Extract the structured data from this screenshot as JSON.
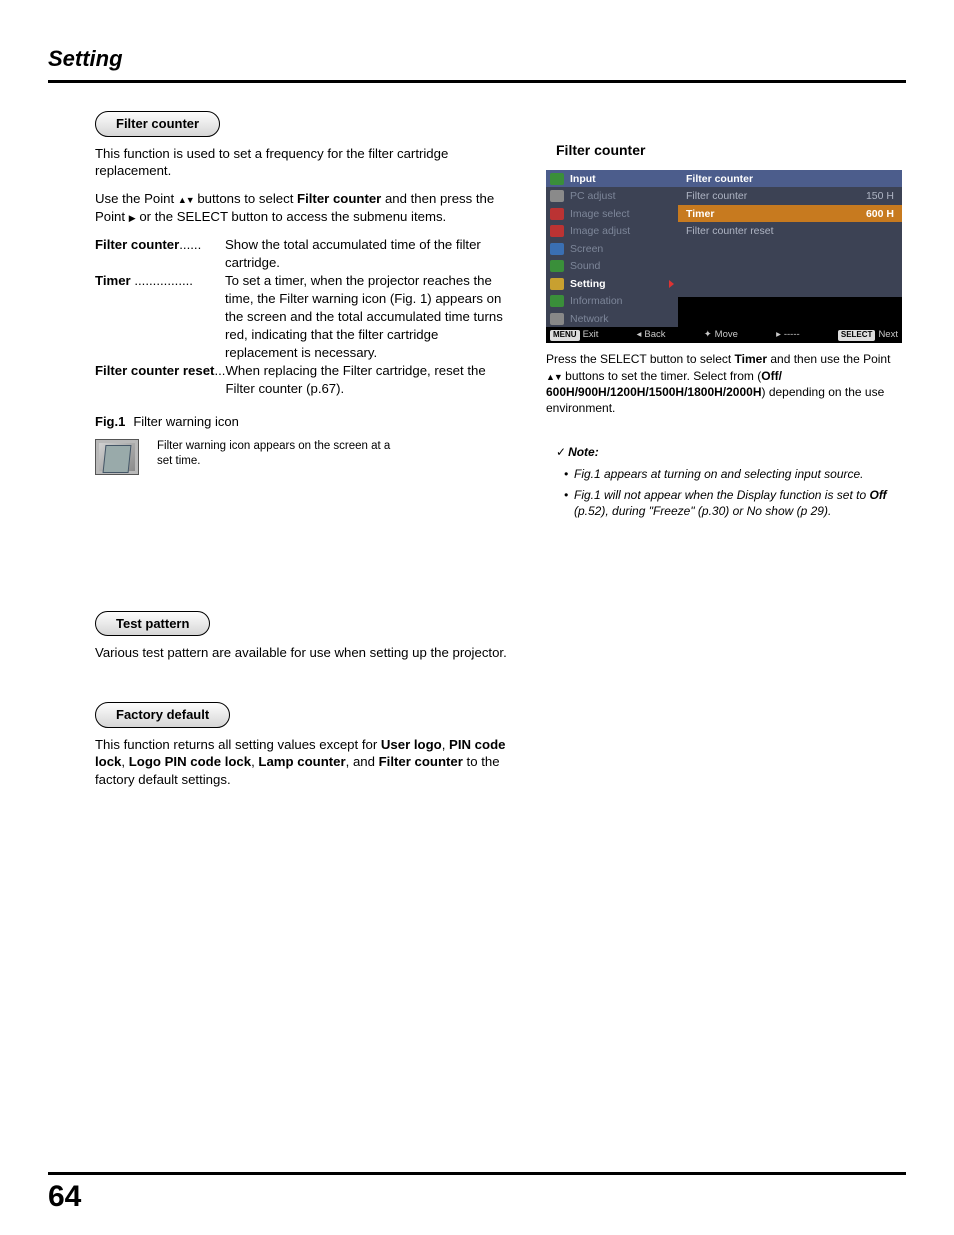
{
  "header": {
    "title": "Setting"
  },
  "pageNumber": "64",
  "pills": {
    "filterCounter": "Filter counter",
    "testPattern": "Test pattern",
    "factoryDefault": "Factory default"
  },
  "intro": {
    "p1": "This function is used to set a frequency for the filter cartridge replacement.",
    "p2a": "Use the Point ",
    "p2b": " buttons to select ",
    "p2bold": "Filter counter",
    "p2c": " and then press the Point ",
    "p2d": " or the SELECT button to access the submenu items."
  },
  "defs": {
    "d1term": "Filter counter",
    "d1dots": "......",
    "d1desc": "Show the total accumulated time of the filter cartridge.",
    "d2term": "Timer",
    "d2dots": " ................",
    "d2desc": "To set a timer, when the projector reaches the time, the Filter warning icon (Fig. 1) appears on the screen and the total accumulated time turns red, indicating that the filter cartridge replacement is necessary.",
    "d3term": "Filter counter reset",
    "d3dots": "...",
    "d3desc": "When replacing the Filter cartridge, reset the Filter counter (p.67)."
  },
  "fig1": {
    "label": "Fig.1",
    "title": "Filter warning icon",
    "caption": "Filter warning icon appears on the screen at a set time."
  },
  "testPattern": {
    "body": "Various test pattern are available for use when setting up the projector."
  },
  "factoryDefault": {
    "pre": "This function returns all setting values except for ",
    "b1": "User logo",
    "s1": ", ",
    "b2": "PIN code lock",
    "s2": ", ",
    "b3": "Logo PIN code lock",
    "s3": ", ",
    "b4": "Lamp counter",
    "s4": ", and ",
    "b5": "Filter counter",
    "post": " to the factory default settings."
  },
  "right": {
    "heading": "Filter counter",
    "osd": {
      "menu": [
        "Input",
        "PC adjust",
        "Image select",
        "Image adjust",
        "Screen",
        "Sound",
        "Setting",
        "Information",
        "Network"
      ],
      "selectedIndex": 6,
      "panelHeader": "Filter counter",
      "items": [
        {
          "label": "Filter counter",
          "value": "150 H",
          "highlight": false
        },
        {
          "label": "Timer",
          "value": "600 H",
          "highlight": true
        },
        {
          "label": "Filter counter reset",
          "value": "",
          "highlight": false
        }
      ],
      "footer": {
        "exitBtn": "MENU",
        "exit": "Exit",
        "back": "Back",
        "move": "Move",
        "dash": "-----",
        "nextBtn": "SELECT",
        "next": "Next"
      }
    },
    "captionBelow": {
      "a": "Press the SELECT button to select ",
      "b": "Timer",
      "c": " and then use the Point ",
      "d": " buttons to set the timer. Select from (",
      "e": "Off/ 600H/900H/1200H/1500H/1800H/2000H",
      "f": ") depending on the use environment."
    },
    "note": {
      "head": "Note:",
      "items": [
        "Fig.1 appears at turning on and selecting input source.",
        {
          "pre": "Fig.1 will not appear when the Display function is set to ",
          "bold": "Off",
          "post": " (p.52), during \"Freeze\" (p.30) or No show (p 29)."
        }
      ]
    }
  },
  "icons": {
    "menuColors": [
      "#3a8f3a",
      "#8a8a8a",
      "#b33",
      "#b33",
      "#3a6fb3",
      "#3a8f3a",
      "#c8a030",
      "#3a8f3a",
      "#888"
    ]
  }
}
